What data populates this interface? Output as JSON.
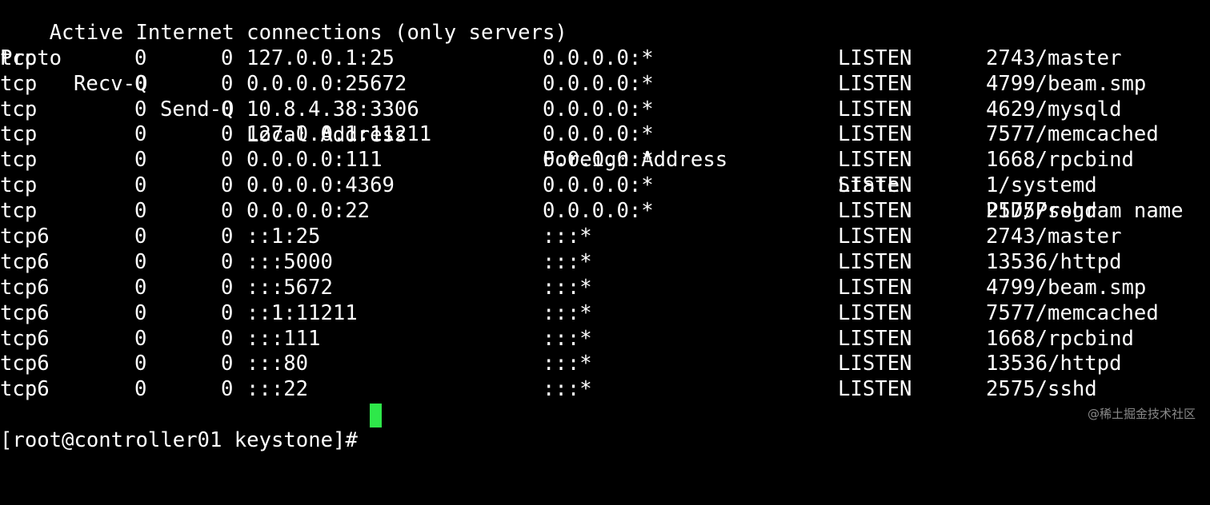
{
  "title": "Active Internet connections (only servers)",
  "headers": {
    "proto": "Proto",
    "recv": "Recv-Q",
    "send": "Send-Q",
    "local": "Local Address",
    "foreign": "Foreign Address",
    "state": "State",
    "pid": "PID/Program name"
  },
  "rows": [
    {
      "proto": "tcp",
      "recv": "0",
      "send": "0",
      "local": "127.0.0.1:25",
      "foreign": "0.0.0.0:*",
      "state": "LISTEN",
      "pid": "2743/master"
    },
    {
      "proto": "tcp",
      "recv": "0",
      "send": "0",
      "local": "0.0.0.0:25672",
      "foreign": "0.0.0.0:*",
      "state": "LISTEN",
      "pid": "4799/beam.smp"
    },
    {
      "proto": "tcp",
      "recv": "0",
      "send": "0",
      "local": "10.8.4.38:3306",
      "foreign": "0.0.0.0:*",
      "state": "LISTEN",
      "pid": "4629/mysqld"
    },
    {
      "proto": "tcp",
      "recv": "0",
      "send": "0",
      "local": "127.0.0.1:11211",
      "foreign": "0.0.0.0:*",
      "state": "LISTEN",
      "pid": "7577/memcached"
    },
    {
      "proto": "tcp",
      "recv": "0",
      "send": "0",
      "local": "0.0.0.0:111",
      "foreign": "0.0.0.0:*",
      "state": "LISTEN",
      "pid": "1668/rpcbind"
    },
    {
      "proto": "tcp",
      "recv": "0",
      "send": "0",
      "local": "0.0.0.0:4369",
      "foreign": "0.0.0.0:*",
      "state": "LISTEN",
      "pid": "1/systemd"
    },
    {
      "proto": "tcp",
      "recv": "0",
      "send": "0",
      "local": "0.0.0.0:22",
      "foreign": "0.0.0.0:*",
      "state": "LISTEN",
      "pid": "2575/sshd"
    },
    {
      "proto": "tcp6",
      "recv": "0",
      "send": "0",
      "local": "::1:25",
      "foreign": ":::*",
      "state": "LISTEN",
      "pid": "2743/master"
    },
    {
      "proto": "tcp6",
      "recv": "0",
      "send": "0",
      "local": ":::5000",
      "foreign": ":::*",
      "state": "LISTEN",
      "pid": "13536/httpd"
    },
    {
      "proto": "tcp6",
      "recv": "0",
      "send": "0",
      "local": ":::5672",
      "foreign": ":::*",
      "state": "LISTEN",
      "pid": "4799/beam.smp"
    },
    {
      "proto": "tcp6",
      "recv": "0",
      "send": "0",
      "local": "::1:11211",
      "foreign": ":::*",
      "state": "LISTEN",
      "pid": "7577/memcached"
    },
    {
      "proto": "tcp6",
      "recv": "0",
      "send": "0",
      "local": ":::111",
      "foreign": ":::*",
      "state": "LISTEN",
      "pid": "1668/rpcbind"
    },
    {
      "proto": "tcp6",
      "recv": "0",
      "send": "0",
      "local": ":::80",
      "foreign": ":::*",
      "state": "LISTEN",
      "pid": "13536/httpd"
    },
    {
      "proto": "tcp6",
      "recv": "0",
      "send": "0",
      "local": ":::22",
      "foreign": ":::*",
      "state": "LISTEN",
      "pid": "2575/sshd"
    }
  ],
  "prompt": "[root@controller01 keystone]# ",
  "watermark": "@稀土掘金技术社区",
  "colors": {
    "background": "#000000",
    "text": "#ffffff",
    "cursor": "#2ee84a",
    "watermark": "#8a8a8a"
  }
}
